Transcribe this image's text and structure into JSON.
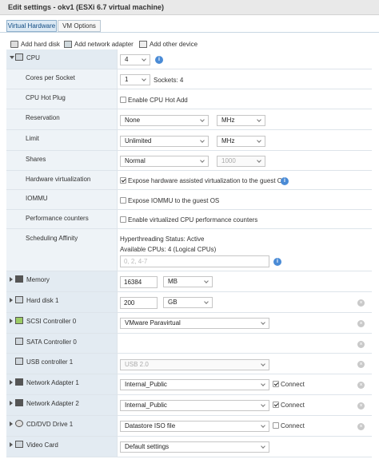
{
  "window": {
    "title": "Edit settings - okv1 (ESXi 6.7 virtual machine)"
  },
  "tabs": [
    {
      "label": "Virtual Hardware",
      "active": true
    },
    {
      "label": "VM Options",
      "active": false
    }
  ],
  "toolbar": {
    "add_hard_disk": "Add hard disk",
    "add_network_adapter": "Add network adapter",
    "add_other_device": "Add other device"
  },
  "cpu": {
    "label": "CPU",
    "value": "4",
    "cores_label": "Cores per Socket",
    "cores_value": "1",
    "sockets_text": "Sockets: 4",
    "hotplug_label": "CPU Hot Plug",
    "hotplug_text": "Enable CPU Hot Add",
    "hotplug_checked": false,
    "reservation_label": "Reservation",
    "reservation_value": "None",
    "reservation_unit": "MHz",
    "limit_label": "Limit",
    "limit_value": "Unlimited",
    "limit_unit": "MHz",
    "shares_label": "Shares",
    "shares_value": "Normal",
    "shares_num": "1000",
    "hwvirt_label": "Hardware virtualization",
    "hwvirt_text": "Expose hardware assisted virtualization to the guest OS",
    "hwvirt_checked": true,
    "iommu_label": "IOMMU",
    "iommu_text": "Expose IOMMU to the guest OS",
    "iommu_checked": false,
    "perf_label": "Performance counters",
    "perf_text": "Enable virtualized CPU performance counters",
    "perf_checked": false,
    "affinity_label": "Scheduling Affinity",
    "affinity_status": "Hyperthreading Status: Active",
    "affinity_available": "Available CPUs: 4 (Logical CPUs)",
    "affinity_placeholder": "0, 2, 4-7"
  },
  "memory": {
    "label": "Memory",
    "value": "16384",
    "unit": "MB"
  },
  "hard_disk": {
    "label": "Hard disk 1",
    "value": "200",
    "unit": "GB"
  },
  "scsi": {
    "label": "SCSI Controller 0",
    "value": "VMware Paravirtual"
  },
  "sata": {
    "label": "SATA Controller 0"
  },
  "usb": {
    "label": "USB controller 1",
    "value": "USB 2.0"
  },
  "net1": {
    "label": "Network Adapter 1",
    "value": "Internal_Public",
    "connect": "Connect",
    "connected": true
  },
  "net2": {
    "label": "Network Adapter 2",
    "value": "Internal_Public",
    "connect": "Connect",
    "connected": true
  },
  "cd": {
    "label": "CD/DVD Drive 1",
    "value": "Datastore ISO file",
    "connect": "Connect",
    "connected": false
  },
  "video": {
    "label": "Video Card",
    "value": "Default settings"
  },
  "icons": {
    "info": "i",
    "remove": "×"
  }
}
